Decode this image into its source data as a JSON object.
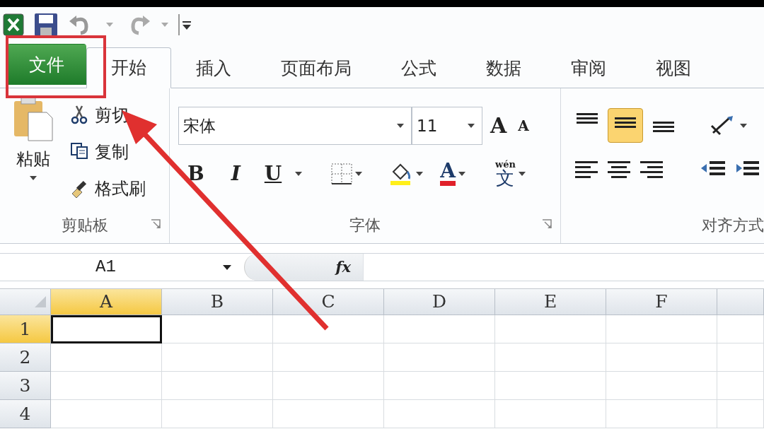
{
  "tabs": [
    {
      "label": "文件",
      "kind": "file",
      "selected": false
    },
    {
      "label": "开始",
      "kind": "tab",
      "selected": true
    },
    {
      "label": "插入",
      "kind": "tab",
      "selected": false
    },
    {
      "label": "页面布局",
      "kind": "tab",
      "selected": false
    },
    {
      "label": "公式",
      "kind": "tab",
      "selected": false
    },
    {
      "label": "数据",
      "kind": "tab",
      "selected": false
    },
    {
      "label": "审阅",
      "kind": "tab",
      "selected": false
    },
    {
      "label": "视图",
      "kind": "tab",
      "selected": false
    }
  ],
  "ribbon": {
    "clipboard": {
      "paste": "粘贴",
      "cut": "剪切",
      "copy": "复制",
      "format_painter": "格式刷",
      "label": "剪贴板"
    },
    "font": {
      "font_name": "宋体",
      "font_size": "11",
      "grow": "A",
      "shrink": "A",
      "bold": "B",
      "italic": "I",
      "underline": "U",
      "font_color": "A",
      "phonetic_top": "wén",
      "phonetic_char": "文",
      "label": "字体"
    },
    "alignment": {
      "vertical": [
        {
          "kind": "top",
          "selected": false
        },
        {
          "kind": "middle",
          "selected": true
        },
        {
          "kind": "bottom",
          "selected": false
        }
      ],
      "label": "对齐方式"
    }
  },
  "formula_bar": {
    "name_box": "A1",
    "fx": "fx"
  },
  "sheet": {
    "columns": [
      {
        "label": "A",
        "selected": true
      },
      {
        "label": "B",
        "selected": false
      },
      {
        "label": "C",
        "selected": false
      },
      {
        "label": "D",
        "selected": false
      },
      {
        "label": "E",
        "selected": false
      },
      {
        "label": "F",
        "selected": false
      }
    ],
    "rows": [
      {
        "label": "1",
        "selected": true
      },
      {
        "label": "2",
        "selected": false
      },
      {
        "label": "3",
        "selected": false
      },
      {
        "label": "4",
        "selected": false
      }
    ]
  }
}
